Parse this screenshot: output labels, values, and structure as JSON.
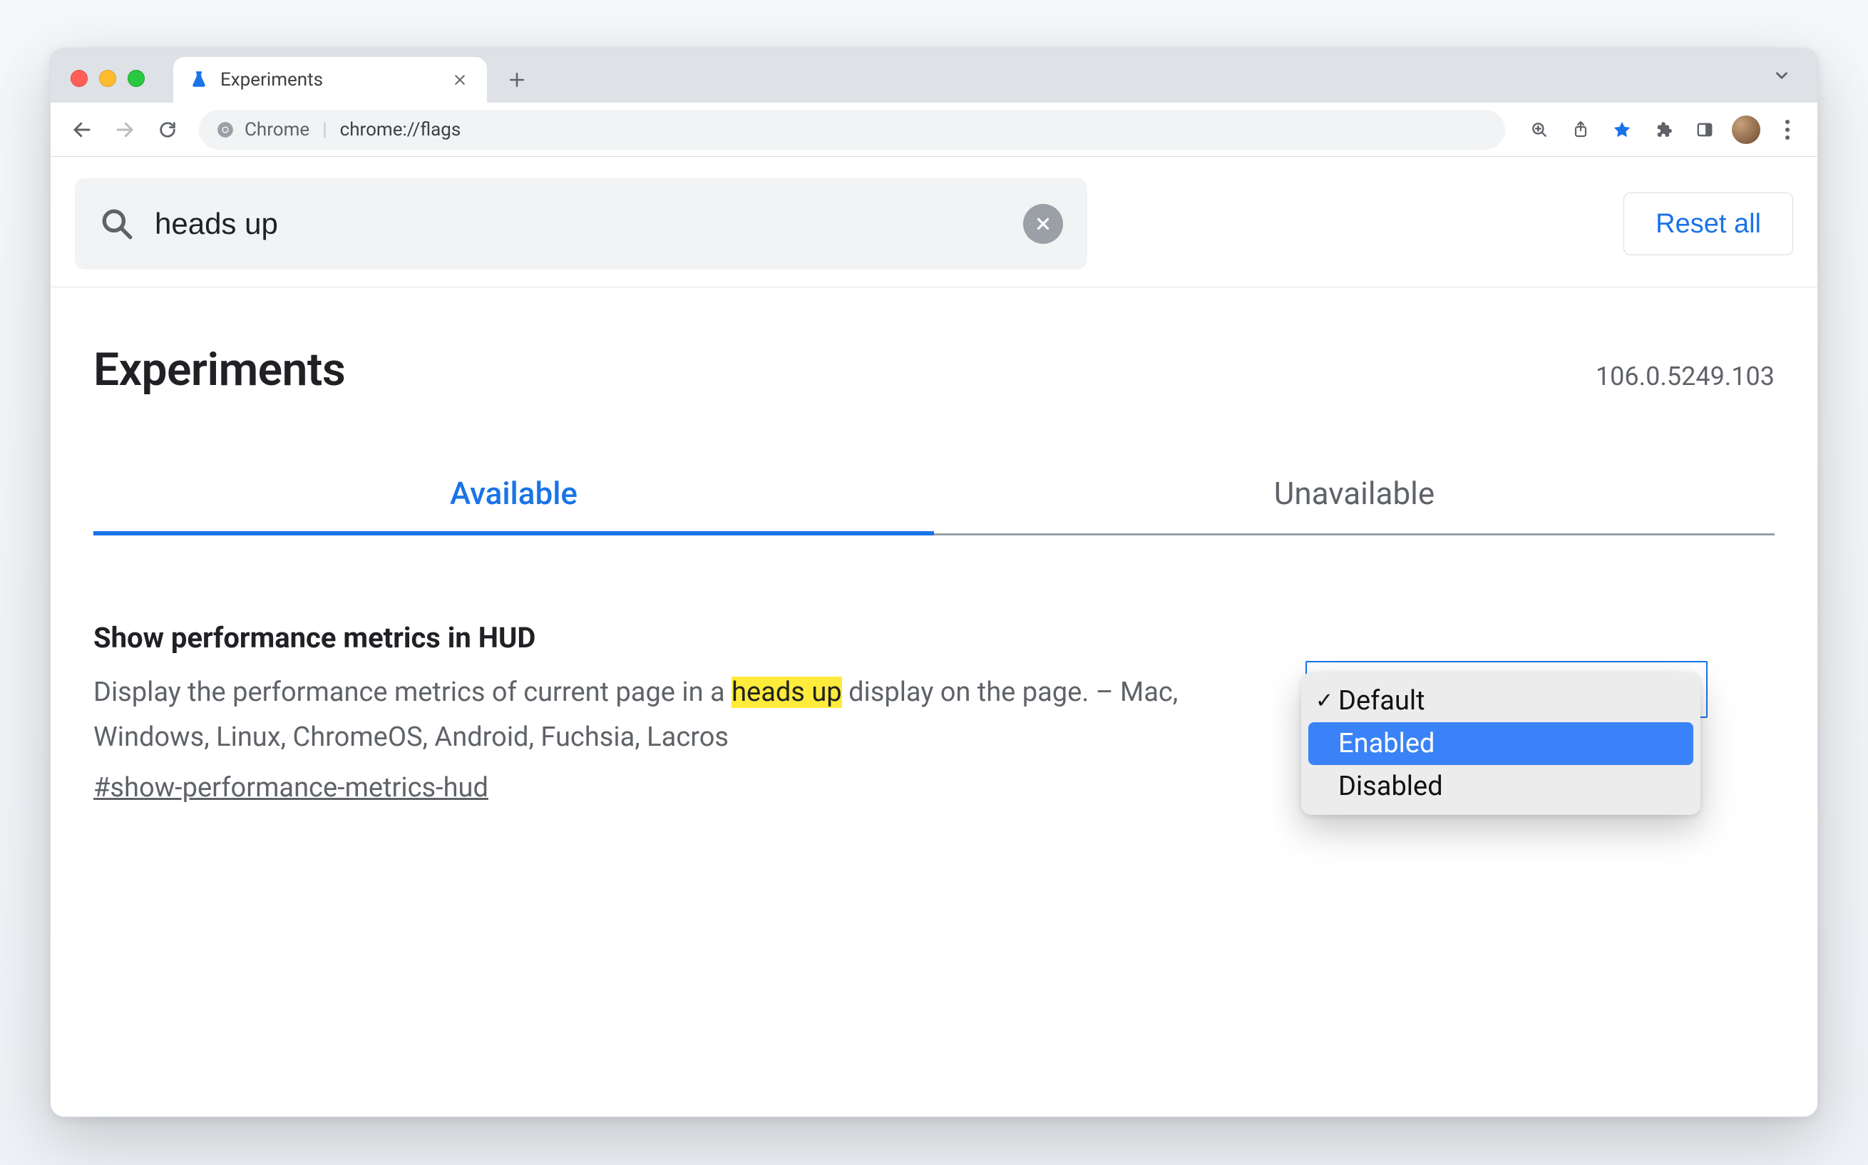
{
  "browser": {
    "tab_title": "Experiments",
    "omnibox_label": "Chrome",
    "omnibox_url": "chrome://flags"
  },
  "search": {
    "value": "heads up",
    "reset_label": "Reset all"
  },
  "header": {
    "title": "Experiments",
    "version": "106.0.5249.103"
  },
  "tabs": {
    "available": "Available",
    "unavailable": "Unavailable"
  },
  "flag": {
    "title": "Show performance metrics in HUD",
    "desc_before": "Display the performance metrics of current page in a ",
    "desc_highlight": "heads up",
    "desc_after": " display on the page. – Mac, Windows, Linux, ChromeOS, Android, Fuchsia, Lacros",
    "anchor": "#show-performance-metrics-hud",
    "options": {
      "default": "Default",
      "enabled": "Enabled",
      "disabled": "Disabled"
    }
  }
}
